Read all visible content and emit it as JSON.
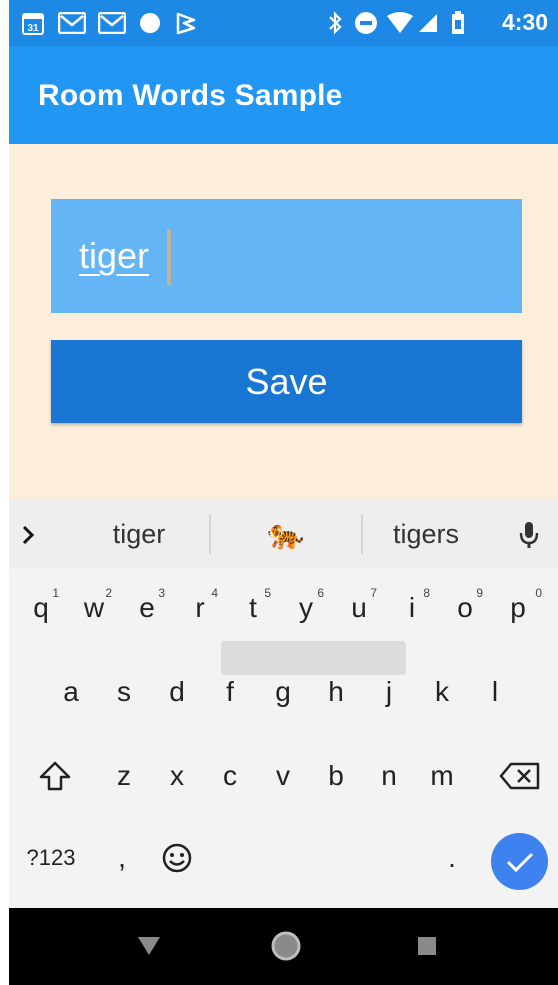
{
  "status_bar": {
    "time": "4:30",
    "left_icons": [
      "calendar-icon",
      "gmail-icon",
      "gmail-icon",
      "circle-icon",
      "flag-icon"
    ],
    "right_icons": [
      "bluetooth-icon",
      "do-not-disturb-icon",
      "wifi-icon",
      "signal-icon",
      "battery-icon"
    ],
    "calendar_date": "31"
  },
  "app_bar": {
    "title": "Room Words Sample"
  },
  "form": {
    "word_value": "tiger",
    "save_label": "Save"
  },
  "keyboard": {
    "suggestions": [
      "tiger",
      "🐅",
      "tigers"
    ],
    "row1": [
      {
        "k": "q",
        "h": "1"
      },
      {
        "k": "w",
        "h": "2"
      },
      {
        "k": "e",
        "h": "3"
      },
      {
        "k": "r",
        "h": "4"
      },
      {
        "k": "t",
        "h": "5"
      },
      {
        "k": "y",
        "h": "6"
      },
      {
        "k": "u",
        "h": "7"
      },
      {
        "k": "i",
        "h": "8"
      },
      {
        "k": "o",
        "h": "9"
      },
      {
        "k": "p",
        "h": "0"
      }
    ],
    "row2": [
      "a",
      "s",
      "d",
      "f",
      "g",
      "h",
      "j",
      "k",
      "l"
    ],
    "row3": [
      "z",
      "x",
      "c",
      "v",
      "b",
      "n",
      "m"
    ],
    "symbols_label": "?123",
    "comma": ",",
    "period": "."
  },
  "colors": {
    "status_bar": "#1e88e5",
    "app_bar": "#2196f3",
    "content_bg": "#fdeedb",
    "input_bg": "#64b5f6",
    "button_bg": "#1976d2",
    "enter_key": "#3e82f0"
  }
}
